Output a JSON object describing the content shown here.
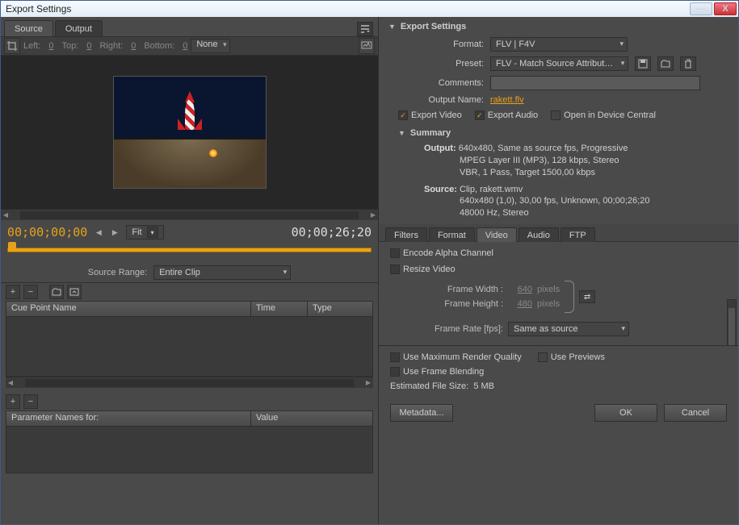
{
  "window": {
    "title": "Export Settings",
    "minimize": "—",
    "close": "X"
  },
  "left": {
    "tabs": {
      "source": "Source",
      "output": "Output"
    },
    "crop": {
      "left_lbl": "Left:",
      "left": "0",
      "top_lbl": "Top:",
      "top": "0",
      "right_lbl": "Right:",
      "right": "0",
      "bottom_lbl": "Bottom:",
      "bottom": "0",
      "ratio": "None"
    },
    "time": {
      "current": "00;00;00;00",
      "fit": "Fit",
      "duration": "00;00;26;20"
    },
    "range": {
      "label": "Source Range:",
      "value": "Entire Clip"
    },
    "cuepoints": {
      "h1": "Cue Point Name",
      "h2": "Time",
      "h3": "Type"
    },
    "params": {
      "h1": "Parameter Names for:",
      "h2": "Value"
    }
  },
  "right": {
    "export_settings": "Export Settings",
    "format": {
      "label": "Format:",
      "value": "FLV | F4V"
    },
    "preset": {
      "label": "Preset:",
      "value": "FLV - Match Source Attribut…"
    },
    "comments": {
      "label": "Comments:"
    },
    "output_name": {
      "label": "Output Name:",
      "value": "rakett.flv"
    },
    "checks": {
      "video": "Export Video",
      "audio": "Export Audio",
      "device": "Open in Device Central"
    },
    "summary": {
      "title": "Summary",
      "out_label": "Output:",
      "out_l1": "640x480, Same as source fps, Progressive",
      "out_l2": "MPEG Layer III (MP3), 128 kbps, Stereo",
      "out_l3": "VBR, 1 Pass, Target 1500,00 kbps",
      "src_label": "Source:",
      "src_l1": "Clip, rakett.wmv",
      "src_l2": "640x480 (1,0), 30,00 fps, Unknown, 00;00;26;20",
      "src_l3": "48000 Hz, Stereo"
    },
    "tabs": {
      "filters": "Filters",
      "format": "Format",
      "video": "Video",
      "audio": "Audio",
      "ftp": "FTP"
    },
    "video": {
      "alpha": "Encode Alpha Channel",
      "resize": "Resize Video",
      "fw_label": "Frame Width :",
      "fw": "640",
      "px": "pixels",
      "fh_label": "Frame Height :",
      "fh": "480",
      "fps_label": "Frame Rate [fps]:",
      "fps": "Same as source"
    },
    "bottom": {
      "maxq": "Use Maximum Render Quality",
      "previews": "Use Previews",
      "blend": "Use Frame Blending",
      "estimate_label": "Estimated File Size:",
      "estimate": "5 MB",
      "metadata": "Metadata...",
      "ok": "OK",
      "cancel": "Cancel"
    }
  }
}
